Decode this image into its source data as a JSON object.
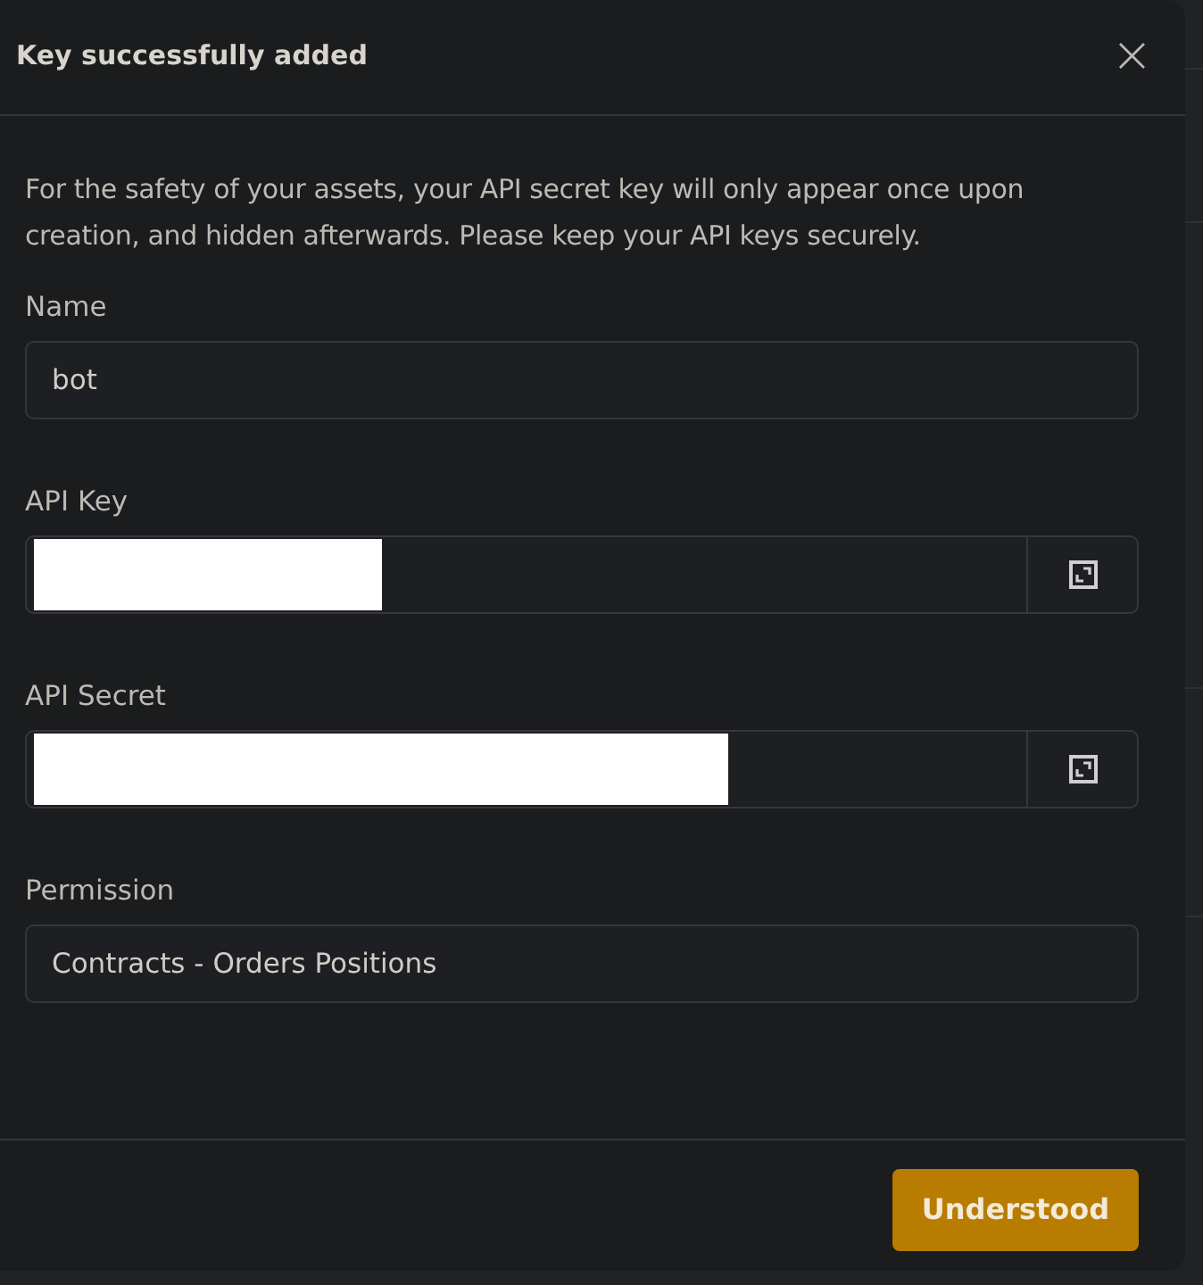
{
  "dialog": {
    "title": "Key successfully added",
    "close_label": "×"
  },
  "notice": "For the safety of your assets, your API secret key will only appear once upon creation, and hidden afterwards. Please keep your API keys securely.",
  "fields": [
    {
      "kind": "text",
      "label": "Name",
      "value": "bot"
    },
    {
      "kind": "copy",
      "label": "API Key",
      "redacted": true
    },
    {
      "kind": "copy",
      "label": "API Secret",
      "redacted": true
    },
    {
      "kind": "text",
      "label": "Permission",
      "value": "Contracts - Orders Positions"
    }
  ],
  "buttons": [
    {
      "label": "Understood"
    }
  ]
}
